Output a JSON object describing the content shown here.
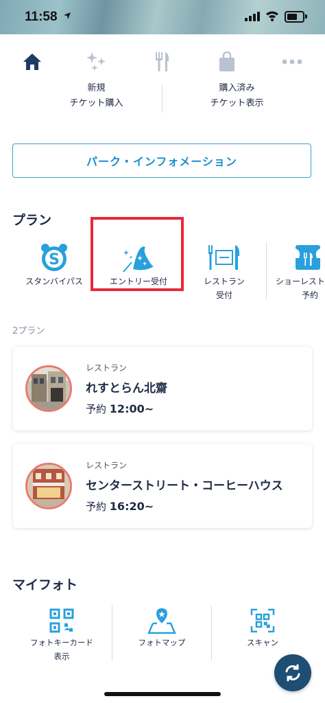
{
  "status": {
    "time": "11:58"
  },
  "nav": {
    "items": [
      {
        "icon": "home-icon"
      },
      {
        "icon": "sparkle-icon"
      },
      {
        "icon": "fork-knife-icon"
      },
      {
        "icon": "shopping-bag-icon"
      },
      {
        "icon": "more-icon"
      }
    ]
  },
  "tickets": {
    "buy_line1": "新規",
    "buy_line2": "チケット購入",
    "view_line1": "購入済み",
    "view_line2": "チケット表示"
  },
  "park_info": {
    "label": "パーク・インフォメーション"
  },
  "plan": {
    "title": "プラン",
    "items": [
      {
        "line1": "スタンバイパス",
        "line2": "",
        "icon": "standby-pass-icon"
      },
      {
        "line1": "エントリー受付",
        "line2": "",
        "icon": "wizard-hat-icon"
      },
      {
        "line1": "レストラン",
        "line2": "受付",
        "icon": "restaurant-icon"
      },
      {
        "line1": "ショーレスト",
        "line2": "予約",
        "icon": "show-restaurant-icon"
      }
    ],
    "count": "2プラン"
  },
  "reservations": [
    {
      "category": "レストラン",
      "name": "れすとらん北齋",
      "prefix": "予約",
      "time": "12:00~"
    },
    {
      "category": "レストラン",
      "name": "センターストリート・コーヒーハウス",
      "prefix": "予約",
      "time": "16:20~"
    }
  ],
  "myphoto": {
    "title": "マイフォト",
    "items": [
      {
        "line1": "フォトキーカード",
        "line2": "表示",
        "icon": "qr-card-icon"
      },
      {
        "line1": "フォトマップ",
        "line2": "",
        "icon": "photo-map-icon"
      },
      {
        "line1": "スキャン",
        "line2": "",
        "icon": "qr-scan-icon"
      }
    ]
  },
  "colors": {
    "accent": "#3aa0d6",
    "navy": "#1f2a44",
    "highlight": "#e8283b"
  }
}
